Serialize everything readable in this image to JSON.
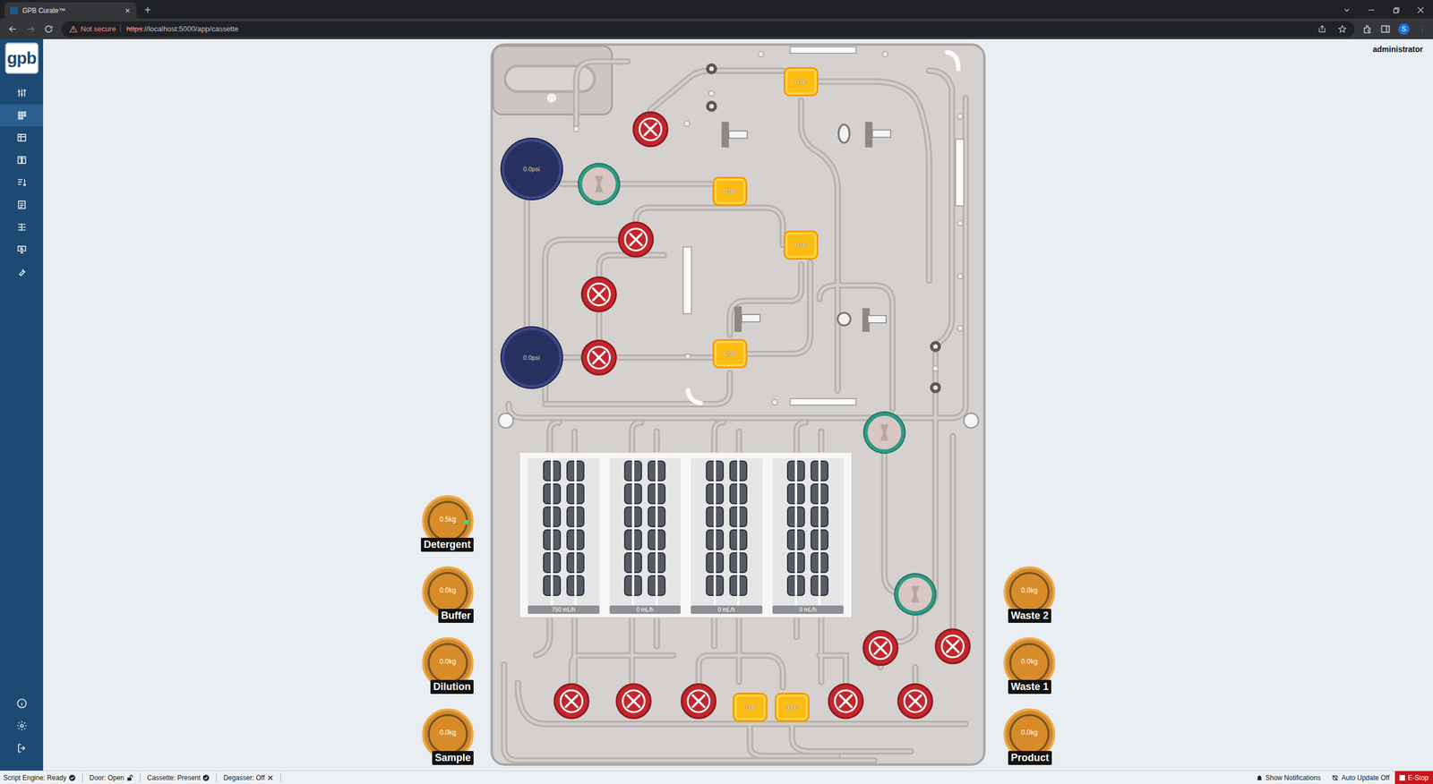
{
  "browser": {
    "tab_title": "GPB Curate™",
    "new_tab": "+",
    "security": "Not secure",
    "url_scheme": "https",
    "url_rest": "://localhost:5000/app/cassette",
    "profile": "S"
  },
  "app": {
    "logo": "gpb",
    "user": "administrator"
  },
  "sidebar": {
    "items": [
      {
        "selected": false
      },
      {
        "selected": true
      },
      {
        "selected": false
      },
      {
        "selected": false
      },
      {
        "selected": false
      },
      {
        "selected": false
      },
      {
        "selected": false
      },
      {
        "selected": false
      },
      {
        "selected": false
      }
    ],
    "bottom_items": [
      {
        "selected": false
      },
      {
        "selected": false
      },
      {
        "selected": false
      }
    ]
  },
  "cassette": {
    "pressure_sensors": [
      {
        "reading": "0.0psi"
      },
      {
        "reading": "0.0psi"
      }
    ],
    "valves": [
      {
        "open": false
      },
      {
        "open": true
      },
      {
        "open": false
      },
      {
        "open": false
      },
      {
        "open": false
      },
      {
        "open": true
      },
      {
        "open": true
      },
      {
        "open": false
      },
      {
        "open": false
      },
      {
        "open": false
      },
      {
        "open": false
      },
      {
        "open": false
      },
      {
        "open": false
      },
      {
        "open": false
      }
    ],
    "flow_sensors": [
      {
        "reading": "0.00"
      },
      {
        "reading": "0.00"
      },
      {
        "reading": "0.00"
      },
      {
        "reading": "0.00"
      },
      {
        "reading": "0.00"
      },
      {
        "reading": "0.00"
      }
    ],
    "pumps": [
      {
        "rate": "750 mL/h"
      },
      {
        "rate": "0 mL/h"
      },
      {
        "rate": "0 mL/h"
      },
      {
        "rate": "0 mL/h"
      }
    ]
  },
  "reservoirs": {
    "left": [
      {
        "name": "Detergent",
        "reading": "0.5kg",
        "indicator": true
      },
      {
        "name": "Buffer",
        "reading": "0.0kg",
        "indicator": false
      },
      {
        "name": "Dilution",
        "reading": "0.0kg",
        "indicator": false
      },
      {
        "name": "Sample",
        "reading": "0.0kg",
        "indicator": false
      }
    ],
    "right": [
      {
        "name": "Waste 2",
        "reading": "0.0kg",
        "indicator": false
      },
      {
        "name": "Waste 1",
        "reading": "0.0kg",
        "indicator": false
      },
      {
        "name": "Product",
        "reading": "0.0kg",
        "indicator": false
      }
    ]
  },
  "status_bar": {
    "items": [
      {
        "label": "Script Engine: Ready",
        "kind": "ok"
      },
      {
        "label": "Door: Open",
        "kind": "unlocked"
      },
      {
        "label": "Cassette: Present",
        "kind": "ok"
      },
      {
        "label": "Degasser: Off",
        "kind": "off"
      }
    ],
    "notifications": "Show Notifications",
    "auto_update": "Auto Update Off",
    "estop": "E-Stop"
  }
}
